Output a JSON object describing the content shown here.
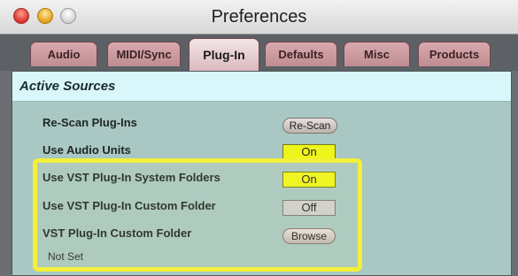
{
  "window": {
    "title": "Preferences"
  },
  "tabs": [
    {
      "label": "Audio"
    },
    {
      "label": "MIDI/Sync"
    },
    {
      "label": "Plug-In"
    },
    {
      "label": "Defaults"
    },
    {
      "label": "Misc"
    },
    {
      "label": "Products"
    }
  ],
  "active_tab": "Plug-In",
  "section": {
    "title": "Active Sources"
  },
  "rows": [
    {
      "label": "Re-Scan Plug-Ins",
      "button": "Re-Scan"
    },
    {
      "label": "Use Audio Units",
      "value": "On"
    },
    {
      "label": "Use VST Plug-In System Folders",
      "value": "On"
    },
    {
      "label": "Use VST Plug-In Custom Folder",
      "value": "Off"
    },
    {
      "label": "VST Plug-In Custom Folder",
      "button": "Browse"
    }
  ],
  "custom_folder_path": "Not Set",
  "colors": {
    "toggle_on": "#eef51a",
    "highlight": "#f2f03a",
    "panel": "#a9c7c3",
    "section_header": "#d9f7fa"
  }
}
